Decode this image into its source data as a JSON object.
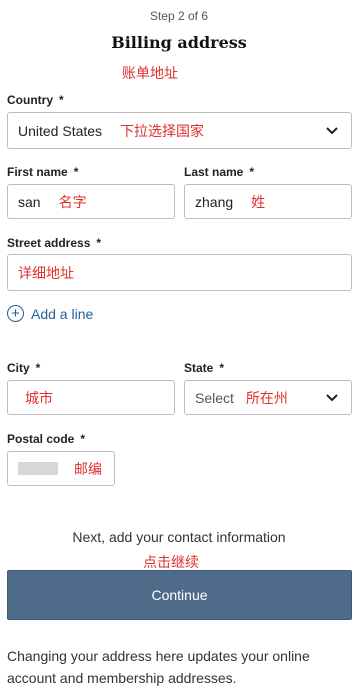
{
  "header": {
    "step": "Step 2 of 6",
    "title": "Billing address",
    "title_note": "账单地址"
  },
  "country": {
    "label": "Country",
    "required_mark": "*",
    "value": "United States",
    "note": "下拉选择国家"
  },
  "first_name": {
    "label": "First name",
    "required_mark": "*",
    "value": "san",
    "note": "名字"
  },
  "last_name": {
    "label": "Last name",
    "required_mark": "*",
    "value": "zhang",
    "note": "姓"
  },
  "street": {
    "label": "Street address",
    "required_mark": "*",
    "note": "详细地址"
  },
  "add_line": {
    "label": "Add a line",
    "icon": "plus-circle-icon"
  },
  "city": {
    "label": "City",
    "required_mark": "*",
    "note": "城市"
  },
  "state": {
    "label": "State",
    "required_mark": "*",
    "value": "Select",
    "note": "所在州"
  },
  "postal": {
    "label": "Postal code",
    "required_mark": "*",
    "note": "邮编"
  },
  "next": {
    "text": "Next, add your contact information",
    "note": "点击继续"
  },
  "continue_button": {
    "label": "Continue"
  },
  "footer": {
    "text": "Changing your address here updates your online account and membership addresses."
  },
  "colors": {
    "accent_button": "#4e6c8a",
    "link": "#1f5f9e",
    "annotation": "#e0312f"
  }
}
